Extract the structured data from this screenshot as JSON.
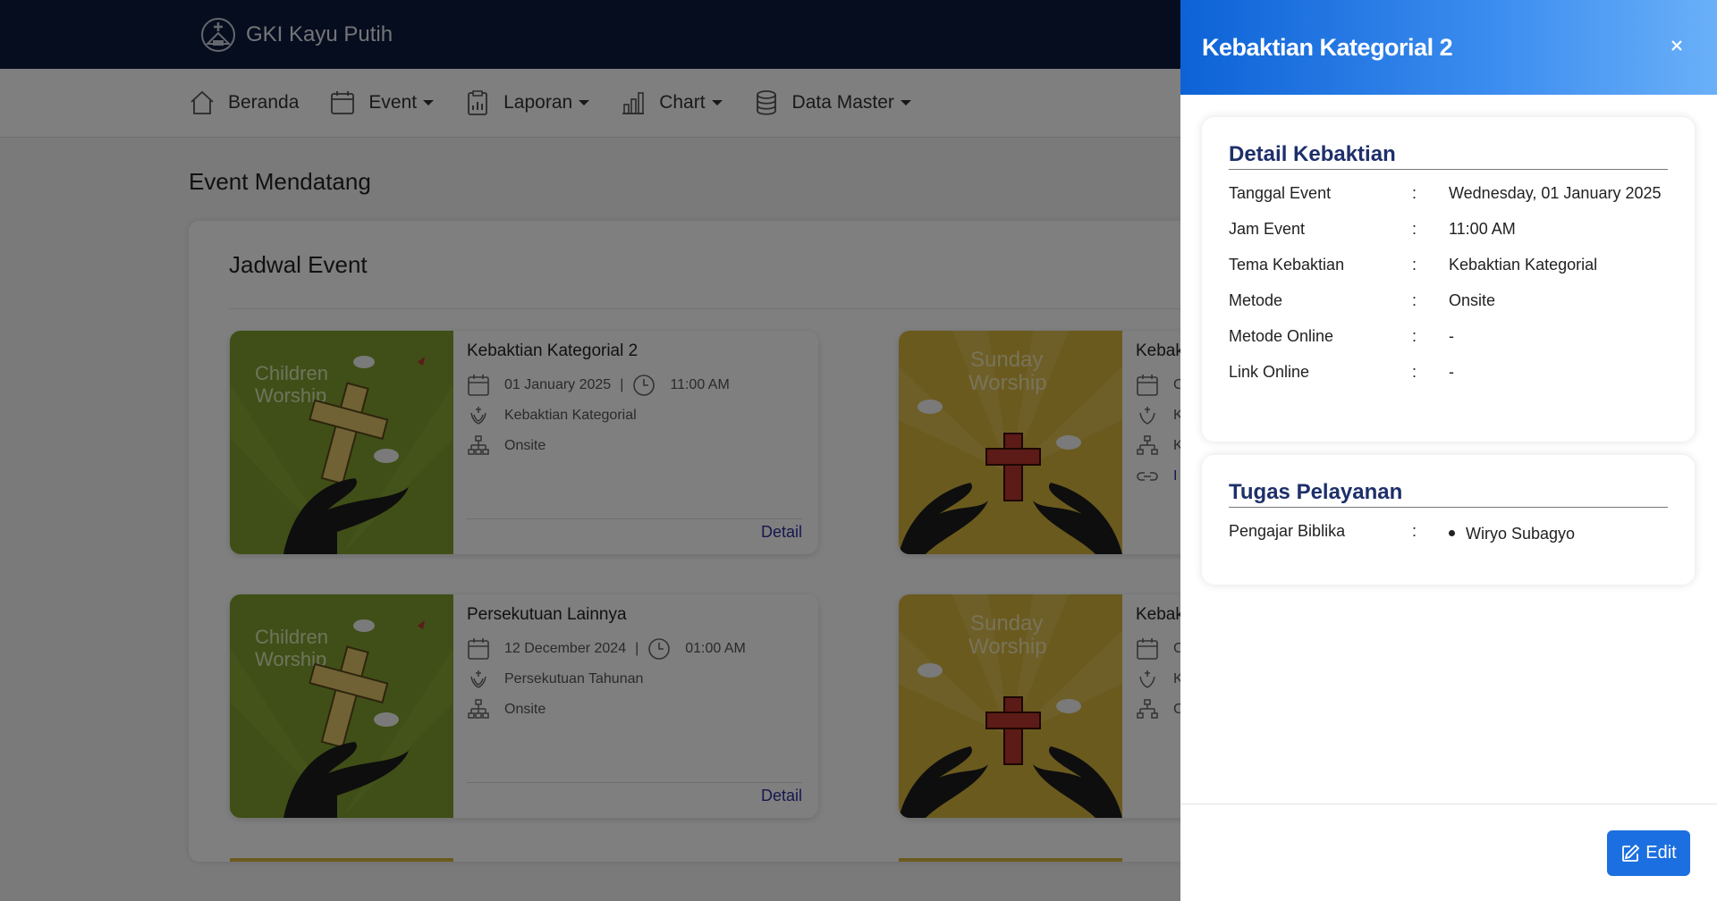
{
  "app": {
    "title": "GKI Kayu Putih",
    "logo_icon": "church-logo-icon"
  },
  "nav": [
    {
      "label": "Beranda",
      "icon": "home-icon",
      "dropdown": false
    },
    {
      "label": "Event",
      "icon": "calendar-icon",
      "dropdown": true
    },
    {
      "label": "Laporan",
      "icon": "report-icon",
      "dropdown": true
    },
    {
      "label": "Chart",
      "icon": "bar-chart-icon",
      "dropdown": true
    },
    {
      "label": "Data Master",
      "icon": "database-icon",
      "dropdown": true
    }
  ],
  "main": {
    "section_title": "Event Mendatang",
    "panel_title": "Jadwal Event",
    "events": [
      {
        "title": "Kebaktian Kategorial 2",
        "date": "01 January 2025",
        "time": "11:00 AM",
        "category": "Kebaktian Kategorial",
        "method": "Onsite",
        "detail_label": "Detail",
        "image_text": "Children Worship",
        "image_color": "#7e9e2e"
      },
      {
        "title": "Persekutuan Lainnya",
        "date": "12 December 2024",
        "time": "01:00 AM",
        "category": "Persekutuan Tahunan",
        "method": "Onsite",
        "detail_label": "Detail",
        "image_text": "Children Worship",
        "image_color": "#7e9e2e"
      },
      {
        "title": "Kebak",
        "image_text": "Sunday Worship",
        "image_color": "#d4b43c",
        "date_partial": "C",
        "category_partial": "K",
        "method_partial": "K",
        "link_partial": "I"
      },
      {
        "title": "Kebak",
        "image_text": "Sunday Worship",
        "image_color": "#d4b43c",
        "date_partial": "C",
        "category_partial": "K",
        "method_partial": "C"
      }
    ]
  },
  "drawer": {
    "title": "Kebaktian Kategorial 2",
    "close_icon": "close-icon",
    "detail": {
      "heading": "Detail Kebaktian",
      "rows": [
        {
          "label": "Tanggal Event",
          "value": "Wednesday, 01 January 2025"
        },
        {
          "label": "Jam Event",
          "value": "11:00 AM"
        },
        {
          "label": "Tema Kebaktian",
          "value": "Kebaktian Kategorial"
        },
        {
          "label": "Metode",
          "value": "Onsite"
        },
        {
          "label": "Metode Online",
          "value": "-"
        },
        {
          "label": "Link Online",
          "value": "-"
        }
      ]
    },
    "tugas": {
      "heading": "Tugas Pelayanan",
      "rows": [
        {
          "label": "Pengajar Biblika",
          "values": [
            "Wiryo Subagyo"
          ]
        }
      ]
    },
    "edit_label": "Edit",
    "colon": ":"
  },
  "colors": {
    "topbar": "#0d1b3e",
    "accent": "#1c6fe0",
    "link": "#2a2f9e",
    "heading": "#1e2f6a"
  }
}
